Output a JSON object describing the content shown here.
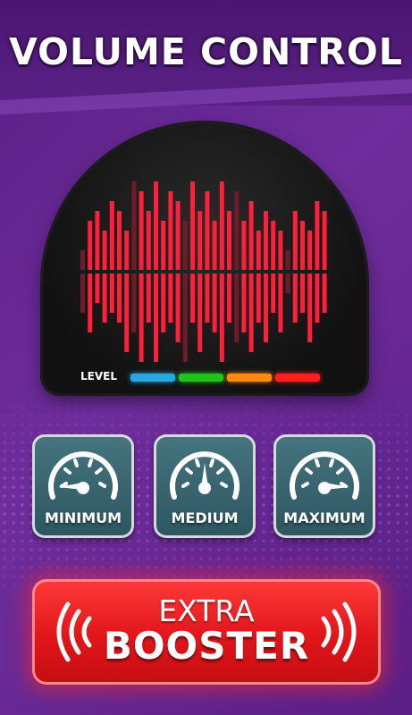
{
  "header": {
    "title": "VOLUME CONTROL"
  },
  "visualizer": {
    "level_label": "LEVEL",
    "bars_up": [
      2,
      5,
      6,
      4,
      7,
      6,
      4,
      9,
      8,
      6,
      9,
      5,
      8,
      7,
      5,
      9,
      6,
      8,
      5,
      9,
      6,
      8,
      5,
      7,
      4,
      6,
      5,
      4,
      2,
      6,
      5,
      4,
      7,
      6
    ],
    "bars_down": [
      4,
      6,
      3,
      5,
      4,
      5,
      8,
      6,
      9,
      5,
      9,
      6,
      5,
      7,
      9,
      5,
      8,
      5,
      6,
      9,
      5,
      7,
      6,
      8,
      5,
      7,
      4,
      6,
      2,
      5,
      4,
      7,
      5,
      4
    ],
    "level_colors": [
      "#2aa7e0",
      "#22c21f",
      "#ff8a10",
      "#ff1f1f"
    ]
  },
  "buttons": [
    {
      "label": "MINIMUM",
      "needle": "min"
    },
    {
      "label": "MEDIUM",
      "needle": "mid"
    },
    {
      "label": "MAXIMUM",
      "needle": "max"
    }
  ],
  "booster": {
    "line1": "EXTRA",
    "line2": "BOOSTER"
  },
  "colors": {
    "bar": "#ff1f3a",
    "bar_dim": "#6e1c27",
    "background": "#6a2a98",
    "button": "#3b6a74",
    "booster": "#e8161b"
  },
  "icons": [
    "speedometer-icon",
    "sound-waves-icon"
  ]
}
